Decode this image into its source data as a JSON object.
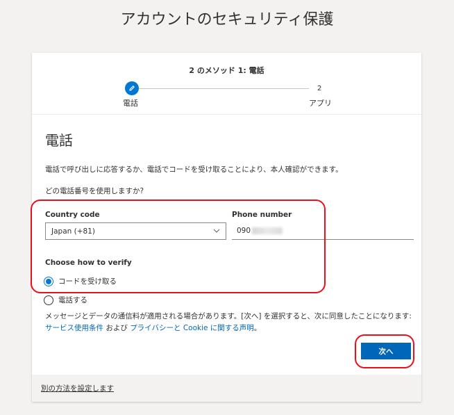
{
  "page": {
    "title": "アカウントのセキュリティ保護"
  },
  "stepper": {
    "title": "2 のメソッド 1: 電話",
    "step1_label": "電話",
    "step2_number": "2",
    "step2_label": "アプリ"
  },
  "section": {
    "title": "電話",
    "description": "電話で呼び出しに応答するか、電話でコードを受け取ることにより、本人確認ができます。",
    "question": "どの電話番号を使用しますか?"
  },
  "country": {
    "label": "Country code",
    "value": "Japan (+81)"
  },
  "phone": {
    "label": "Phone number",
    "value": "090"
  },
  "verify": {
    "label": "Choose how to verify",
    "options": [
      {
        "label": "コードを受け取る",
        "selected": true
      },
      {
        "label": "電話する",
        "selected": false
      }
    ]
  },
  "notice": {
    "text1": "メッセージとデータの通信料が適用される場合があります。[次へ] を選択すると、次に同意したことになります: ",
    "link1": "サービス使用条件",
    "text2": " および ",
    "link2": "プライバシーと Cookie に関する声明",
    "text3": "。"
  },
  "next_button": "次へ",
  "footer_link": "別の方法を設定します",
  "colors": {
    "accent": "#0078d4",
    "button": "#0067b8",
    "highlight": "#e8101a"
  }
}
